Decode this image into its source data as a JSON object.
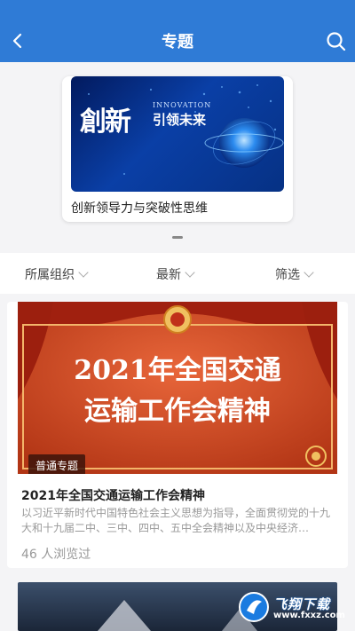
{
  "header": {
    "title": "专题"
  },
  "featured": {
    "caption": "创新领导力与突破性思维",
    "banner_title_cn": "創新",
    "banner_sub_cn": "引领未来",
    "banner_en": "INNOVATION"
  },
  "filters": [
    {
      "label": "所属组织"
    },
    {
      "label": "最新"
    },
    {
      "label": "筛选"
    }
  ],
  "list": [
    {
      "banner_line1": "2021年全国交通",
      "banner_line2": "运输工作会精神",
      "tag": "普通专题",
      "title": "2021年全国交通运输工作会精神",
      "desc": "以习近平新时代中国特色社会主义思想为指导，全面贯彻党的十九大和十九届二中、三中、四中、五中全会精神以及中央经济…",
      "views": "46 人浏览过"
    }
  ],
  "watermark": {
    "text": "飞翔下载",
    "url": "www.fxxz.com"
  },
  "colors": {
    "header": "#2f7bd6",
    "banner_red": "#c4451e"
  }
}
